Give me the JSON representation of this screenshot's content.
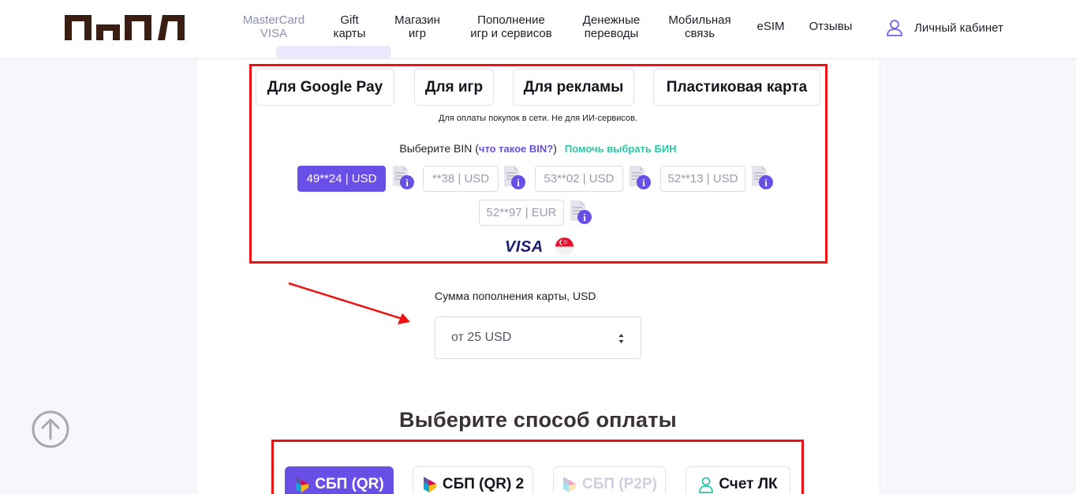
{
  "header": {
    "nav": [
      {
        "line1": "MasterCard",
        "line2": "VISA"
      },
      {
        "line1": "Gift",
        "line2": "карты"
      },
      {
        "line1": "Магазин",
        "line2": "игр"
      },
      {
        "line1": "Пополнение",
        "line2": "игр и сервисов"
      },
      {
        "line1": "Денежные",
        "line2": "переводы"
      },
      {
        "line1": "Мобильная",
        "line2": "связь"
      },
      {
        "line1": "eSIM"
      },
      {
        "line1": "Отзывы"
      }
    ],
    "cabinet_label": "Личный кабинет",
    "logo_icon": "brand-logo",
    "cabinet_icon": "user-icon"
  },
  "card_types": {
    "tabs": [
      "Для Google Pay",
      "Для игр",
      "Для рекламы",
      "Пластиковая карта"
    ],
    "note": "Для оплаты покупок в сети. Не для ИИ-сервисов."
  },
  "bin": {
    "label_prefix": "Выберите BIN (",
    "what_is_link": "что такое BIN?",
    "label_suffix": ")",
    "help_link": "Помочь выбрать БИН",
    "options": [
      "49**24 | USD",
      "**38 | USD",
      "53**02 | USD",
      "52**13 | USD",
      "52**97 | EUR"
    ],
    "selected": "49**24 | USD",
    "brand": "VISA",
    "info_icon": "document-info-icon",
    "flag_icon": "singapore-flag-icon"
  },
  "amount": {
    "label": "Сумма пополнения карты, USD",
    "placeholder": "от 25 USD"
  },
  "payment": {
    "title": "Выберите способ оплаты",
    "methods": [
      "СБП (QR)",
      "СБП (QR) 2",
      "СБП (P2P)",
      "Счет ЛК"
    ],
    "selected": "СБП (QR)",
    "disabled": "СБП (P2P)"
  },
  "colors": {
    "accent": "#6a4fe6",
    "annotation_red": "#ee1111",
    "help_link": "#2ec4a6",
    "logo": "#3a1e14"
  }
}
